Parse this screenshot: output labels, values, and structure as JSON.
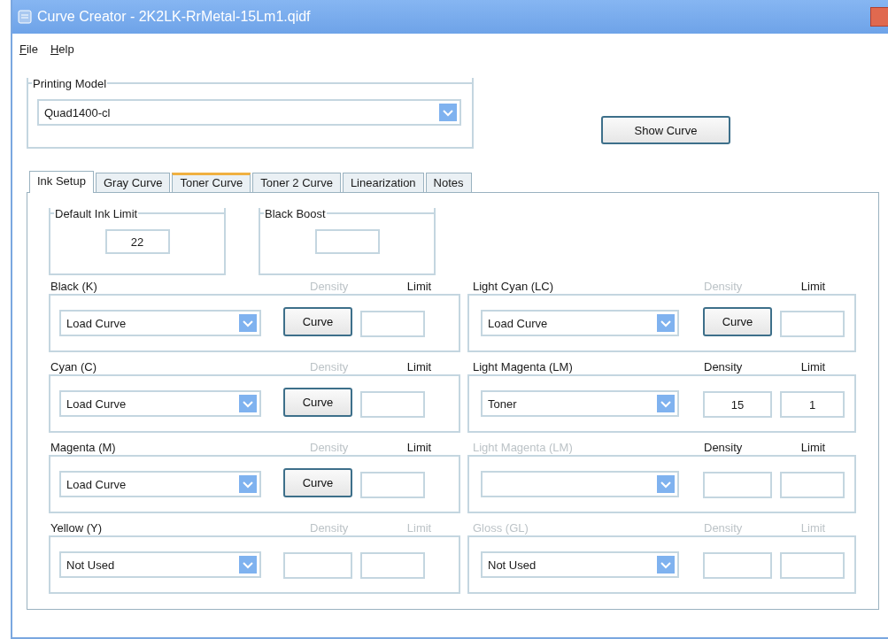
{
  "window": {
    "title": "Curve Creator - 2K2LK-RrMetal-15Lm1.qidf"
  },
  "menu": [
    {
      "label": "File"
    },
    {
      "label": "Help"
    }
  ],
  "printing_model": {
    "legend": "Printing Model",
    "value": "Quad1400-cl"
  },
  "show_curve_button": "Show Curve",
  "tabs": [
    {
      "label": "Ink Setup",
      "selected": true,
      "hovered": false
    },
    {
      "label": "Gray Curve",
      "selected": false,
      "hovered": false
    },
    {
      "label": "Toner Curve",
      "selected": false,
      "hovered": true
    },
    {
      "label": "Toner 2 Curve",
      "selected": false,
      "hovered": false
    },
    {
      "label": "Linearization",
      "selected": false,
      "hovered": false
    },
    {
      "label": "Notes",
      "selected": false,
      "hovered": false
    }
  ],
  "ink_limit": {
    "legend": "Default Ink Limit",
    "value": "22"
  },
  "black_boost": {
    "legend": "Black Boost"
  },
  "channels": [
    {
      "name": "Black (K)",
      "name_disabled": false,
      "density_header": "Density",
      "density_disabled": true,
      "limit_header": "Limit",
      "limit_disabled": false,
      "mode": "Load Curve",
      "kind": "button",
      "button_label": "Curve"
    },
    {
      "name": "Light Cyan (LC)",
      "name_disabled": false,
      "density_header": "Density",
      "density_disabled": true,
      "limit_header": "Limit",
      "limit_disabled": false,
      "mode": "Load Curve",
      "kind": "button",
      "button_label": "Curve"
    },
    {
      "name": "Cyan (C)",
      "name_disabled": false,
      "density_header": "Density",
      "density_disabled": true,
      "limit_header": "Limit",
      "limit_disabled": false,
      "mode": "Load Curve",
      "kind": "button",
      "button_label": "Curve"
    },
    {
      "name": "Light Magenta (LM)",
      "name_disabled": false,
      "density_header": "Density",
      "density_disabled": false,
      "limit_header": "Limit",
      "limit_disabled": false,
      "mode": "Toner",
      "kind": "field",
      "density": "15",
      "limit": "1"
    },
    {
      "name": "Magenta (M)",
      "name_disabled": false,
      "density_header": "Density",
      "density_disabled": true,
      "limit_header": "Limit",
      "limit_disabled": false,
      "mode": "Load Curve",
      "kind": "button",
      "button_label": "Curve"
    },
    {
      "name": "Light Magenta (LM)",
      "name_disabled": true,
      "density_header": "Density",
      "density_disabled": false,
      "limit_header": "Limit",
      "limit_disabled": false,
      "kind": "field"
    },
    {
      "name": "Yellow (Y)",
      "name_disabled": false,
      "density_header": "Density",
      "density_disabled": true,
      "limit_header": "Limit",
      "limit_disabled": true,
      "mode": "Not Used",
      "kind": "field"
    },
    {
      "name": "Gloss (GL)",
      "name_disabled": true,
      "density_header": "Density",
      "density_disabled": true,
      "limit_header": "Limit",
      "limit_disabled": true,
      "mode": "Not Used",
      "kind": "field"
    }
  ]
}
